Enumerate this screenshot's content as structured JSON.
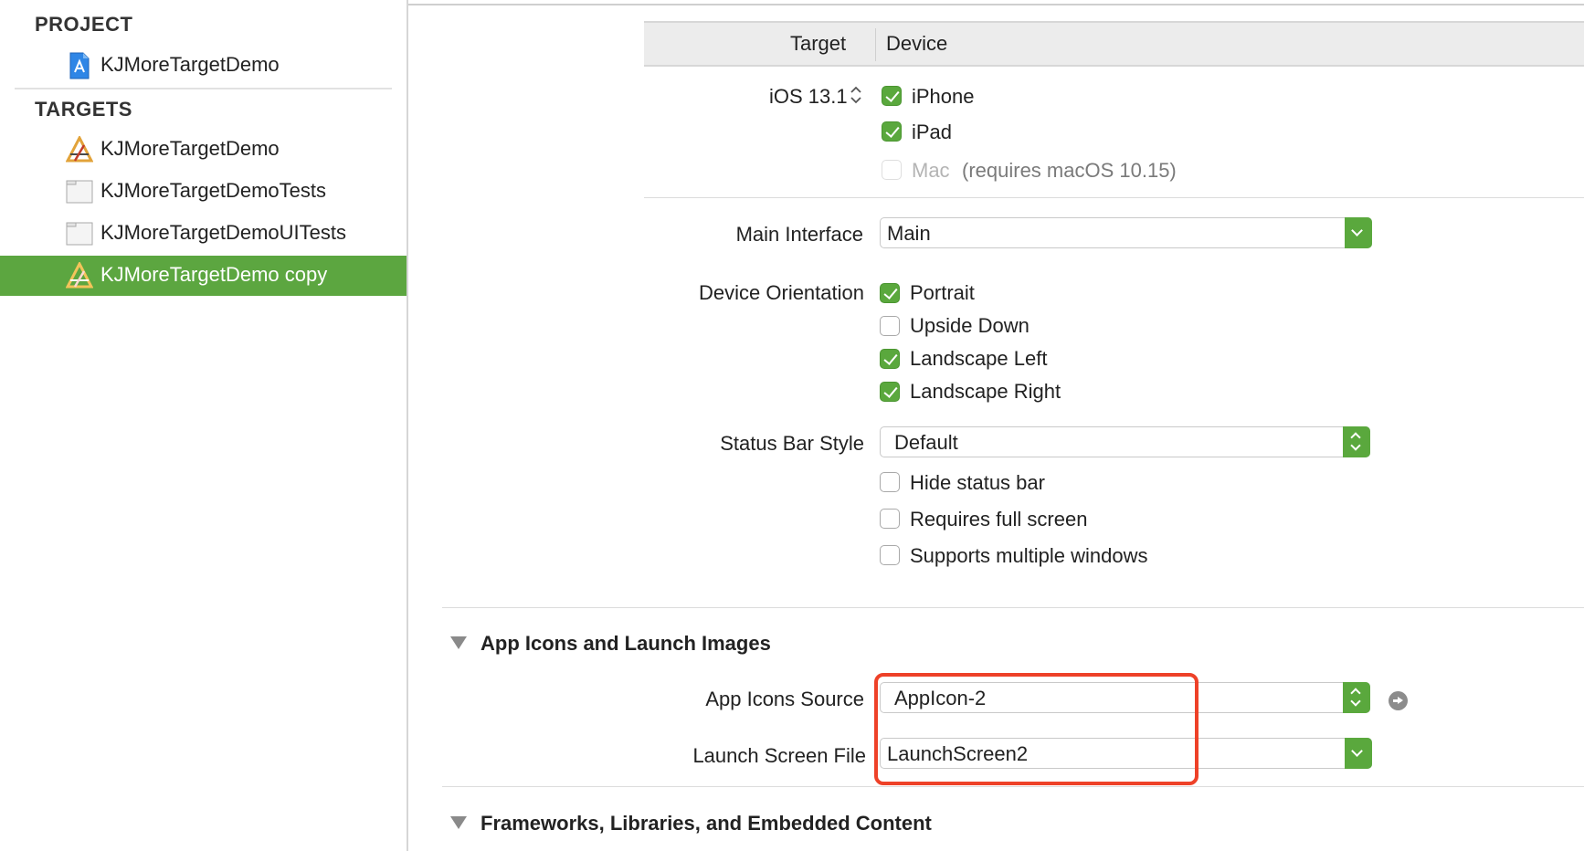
{
  "sidebar": {
    "project_heading": "PROJECT",
    "project_item": "KJMoreTargetDemo",
    "targets_heading": "TARGETS",
    "targets": [
      {
        "label": "KJMoreTargetDemo",
        "icon": "app-target-icon"
      },
      {
        "label": "KJMoreTargetDemoTests",
        "icon": "test-bundle-icon"
      },
      {
        "label": "KJMoreTargetDemoUITests",
        "icon": "test-bundle-icon"
      },
      {
        "label": "KJMoreTargetDemo copy",
        "icon": "app-target-icon",
        "selected": true
      }
    ]
  },
  "deployment": {
    "col_target": "Target",
    "col_device": "Device",
    "ios_version": "iOS 13.1",
    "devices": [
      {
        "label": "iPhone",
        "checked": true
      },
      {
        "label": "iPad",
        "checked": true
      },
      {
        "label": "Mac",
        "note": "(requires macOS 10.15)",
        "checked": false,
        "disabled": true
      }
    ]
  },
  "main_interface": {
    "label": "Main Interface",
    "value": "Main"
  },
  "orientation": {
    "label": "Device Orientation",
    "options": [
      {
        "label": "Portrait",
        "checked": true
      },
      {
        "label": "Upside Down",
        "checked": false
      },
      {
        "label": "Landscape Left",
        "checked": true
      },
      {
        "label": "Landscape Right",
        "checked": true
      }
    ]
  },
  "status_bar": {
    "label": "Status Bar Style",
    "value": "Default",
    "options": [
      {
        "label": "Hide status bar",
        "checked": false
      },
      {
        "label": "Requires full screen",
        "checked": false
      },
      {
        "label": "Supports multiple windows",
        "checked": false
      }
    ]
  },
  "app_icons_section": {
    "title": "App Icons and Launch Images",
    "icons_source_label": "App Icons Source",
    "icons_source_value": "AppIcon-2",
    "launch_screen_label": "Launch Screen File",
    "launch_screen_value": "LaunchScreen2"
  },
  "frameworks_section": {
    "title": "Frameworks, Libraries, and Embedded Content"
  },
  "colors": {
    "accent": "#5aa83d",
    "selection": "#5ca640",
    "highlight": "#ee4128"
  }
}
